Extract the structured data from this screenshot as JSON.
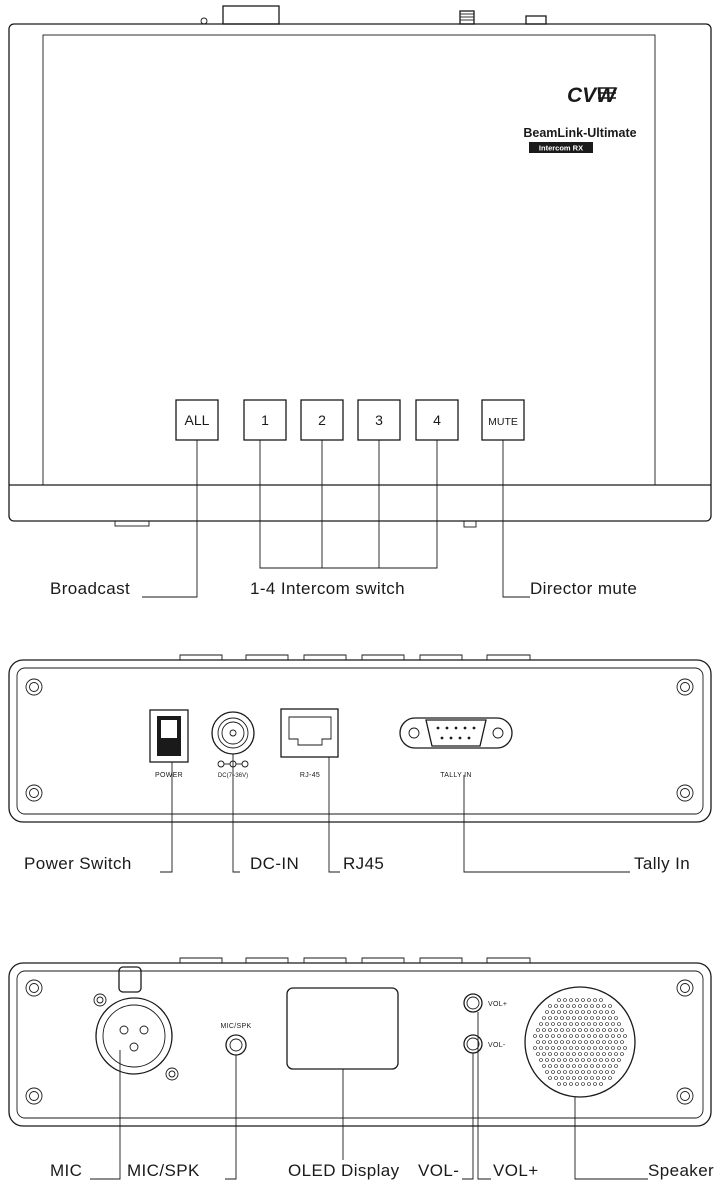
{
  "brand": {
    "logo": "CVW",
    "product": "BeamLink-Ultimate",
    "model_badge": "Intercom RX"
  },
  "top_view": {
    "buttons": [
      "ALL",
      "1",
      "2",
      "3",
      "4",
      "MUTE"
    ],
    "callouts": {
      "broadcast": "Broadcast",
      "intercom": "1-4 Intercom switch",
      "director": "Director mute"
    }
  },
  "rear_panel": {
    "power_label": "POWER",
    "dc_label": "DC(7~36V)",
    "rj45_label": "RJ-45",
    "tally_label": "TALLY IN",
    "callouts": {
      "power": "Power Switch",
      "dc": "DC-IN",
      "rj45": "RJ45",
      "tally": "Tally In"
    }
  },
  "front_panel": {
    "micspk_label": "MIC/SPK",
    "volplus_label": "VOL+",
    "volminus_label": "VOL-",
    "callouts": {
      "mic": "MIC",
      "micspk": "MIC/SPK",
      "oled": "OLED Display",
      "volminus": "VOL-",
      "volplus": "VOL+",
      "speaker": "Speaker"
    }
  }
}
